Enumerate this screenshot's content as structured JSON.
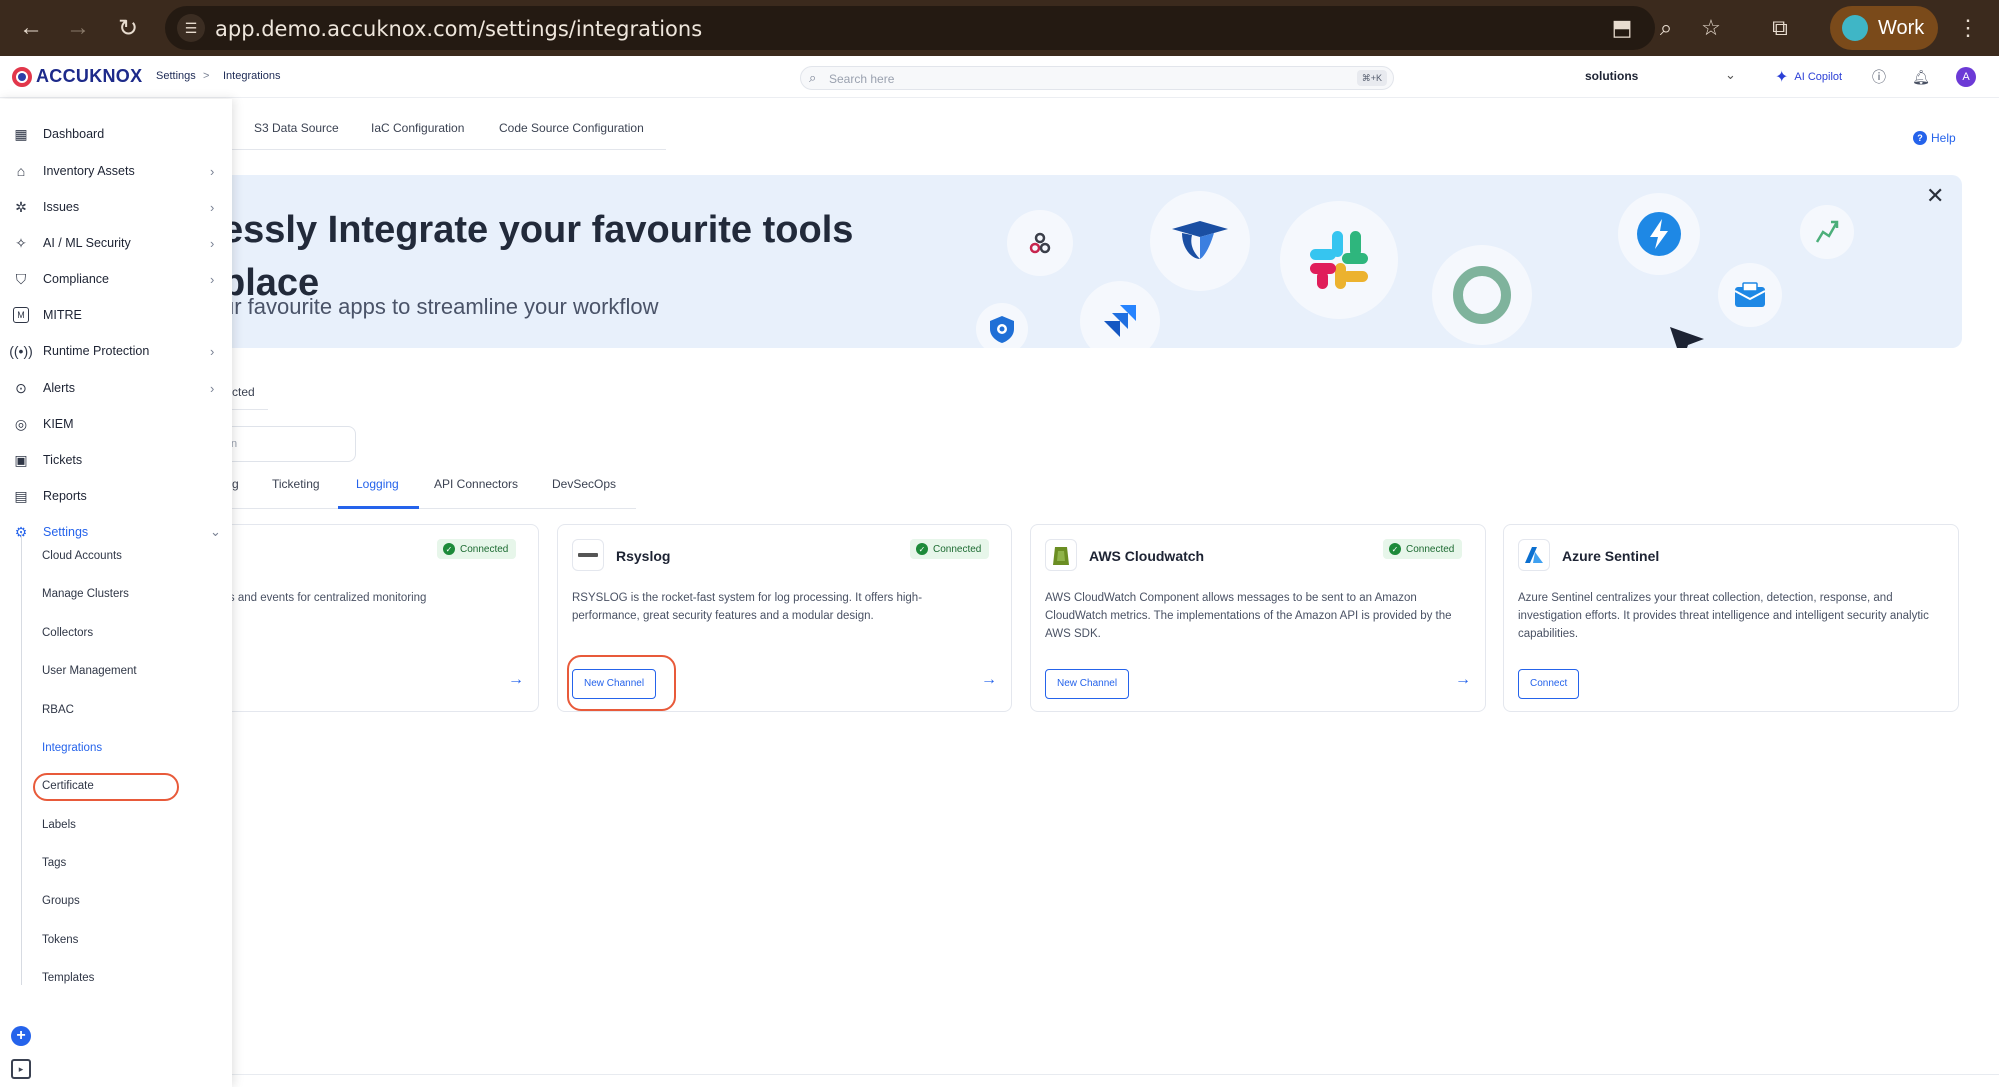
{
  "browser": {
    "url": "app.demo.accuknox.com/settings/integrations",
    "profile_label": "Work"
  },
  "topbar": {
    "brand": "ACCUKNOX",
    "breadcrumb": [
      "Settings",
      "Integrations"
    ],
    "breadcrumb_separator": ">",
    "search_placeholder": "Search here",
    "search_shortcut": "⌘+K",
    "workspace": "solutions",
    "copilot_label": "AI Copilot",
    "user_initial": "A"
  },
  "subnav": [
    "S3 Data Source",
    "IaC Configuration",
    "Code Source Configuration"
  ],
  "help_label": "Help",
  "banner": {
    "title_line1": "essly Integrate your favourite tools",
    "title_line2": "place",
    "subtitle": "ur favourite apps to streamline your workflow",
    "close": "✕"
  },
  "left_tab": "cted",
  "filter_placeholder": "n",
  "category_tabs": [
    "g",
    "Ticketing",
    "Logging",
    "API Connectors",
    "DevSecOps"
  ],
  "active_category": "Logging",
  "cards": [
    {
      "title": "",
      "status": "Connected",
      "description": "l security logs and events for centralized monitoring",
      "button": ""
    },
    {
      "title": "Rsyslog",
      "status": "Connected",
      "description": "RSYSLOG is the rocket-fast system for log processing. It offers high-performance, great security features and a modular design.",
      "button": "New Channel"
    },
    {
      "title": "AWS Cloudwatch",
      "status": "Connected",
      "description": "AWS CloudWatch Component allows messages to be sent to an Amazon CloudWatch metrics. The implementations of the Amazon API is provided by the AWS SDK.",
      "button": "New Channel"
    },
    {
      "title": "Azure Sentinel",
      "status": "",
      "description": "Azure Sentinel centralizes your threat collection, detection, response, and investigation efforts. It provides threat intelligence and intelligent security analytic capabilities.",
      "button": "Connect"
    }
  ],
  "sidebar": {
    "items": [
      {
        "label": "Dashboard",
        "icon": "dashboard-icon"
      },
      {
        "label": "Inventory Assets",
        "icon": "inventory-icon"
      },
      {
        "label": "Issues",
        "icon": "bug-icon"
      },
      {
        "label": "AI / ML Security",
        "icon": "sparkle-icon"
      },
      {
        "label": "Compliance",
        "icon": "shield-check-icon"
      },
      {
        "label": "MITRE",
        "icon": "mitre-icon"
      },
      {
        "label": "Runtime Protection",
        "icon": "radio-icon"
      },
      {
        "label": "Alerts",
        "icon": "alert-icon"
      },
      {
        "label": "KIEM",
        "icon": "fingerprint-icon"
      },
      {
        "label": "Tickets",
        "icon": "ticket-icon"
      },
      {
        "label": "Reports",
        "icon": "report-icon"
      },
      {
        "label": "Settings",
        "icon": "gear-icon"
      }
    ],
    "settings_children": [
      "Cloud Accounts",
      "Manage Clusters",
      "Collectors",
      "User Management",
      "RBAC",
      "Integrations",
      "Certificate",
      "Labels",
      "Tags",
      "Groups",
      "Tokens",
      "Templates"
    ]
  },
  "colors": {
    "accent": "#2563eb",
    "highlight": "#e85a3a",
    "connected_bg": "#e7f6ea"
  }
}
